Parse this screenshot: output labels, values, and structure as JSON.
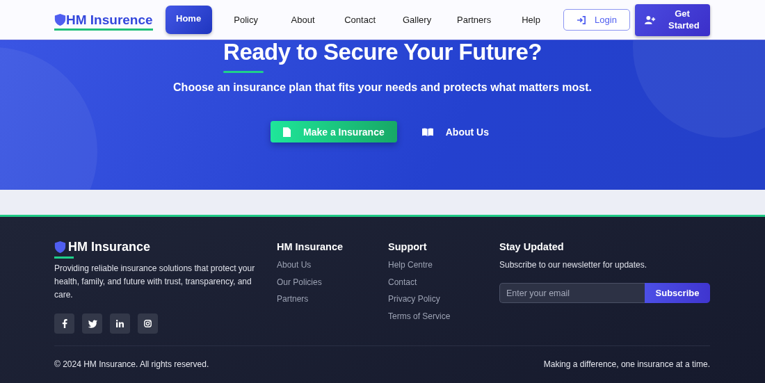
{
  "header": {
    "logo": "HM Insurence",
    "nav": [
      {
        "label": "Home",
        "selected": true
      },
      {
        "label": "Policy",
        "selected": false
      },
      {
        "label": "About",
        "selected": false
      },
      {
        "label": "Contact",
        "selected": false
      },
      {
        "label": "Gallery",
        "selected": false
      },
      {
        "label": "Partners",
        "selected": false
      },
      {
        "label": "Help",
        "selected": false
      }
    ],
    "login": "Login",
    "get_started": "Get Started"
  },
  "hero": {
    "title": "Ready to Secure Your Future?",
    "subtitle": "Choose an insurance plan that fits your needs and protects what matters most.",
    "primary_button": "Make a Insurance",
    "secondary_button": "About Us"
  },
  "footer": {
    "brand": "HM Insurance",
    "description": "Providing reliable insurance solutions that protect your health, family, and future with trust, transparency, and care.",
    "socials": [
      {
        "kind": "facebook"
      },
      {
        "kind": "twitter"
      },
      {
        "kind": "linkedin"
      },
      {
        "kind": "instagram"
      }
    ],
    "columns": [
      {
        "title": "HM Insurance",
        "links": [
          "About Us",
          "Our Policies",
          "Partners"
        ]
      },
      {
        "title": "Support",
        "links": [
          "Help Centre",
          "Contact",
          "Privacy Policy",
          "Terms of Service"
        ]
      }
    ],
    "newsletter": {
      "title": "Stay Updated",
      "text": "Subscribe to our newsletter for updates.",
      "placeholder": "Enter your email",
      "button": "Subscribe"
    },
    "copyright": "© 2024 HM Insurance. All rights reserved.",
    "tagline": "Making a difference, one insurance at a time."
  }
}
